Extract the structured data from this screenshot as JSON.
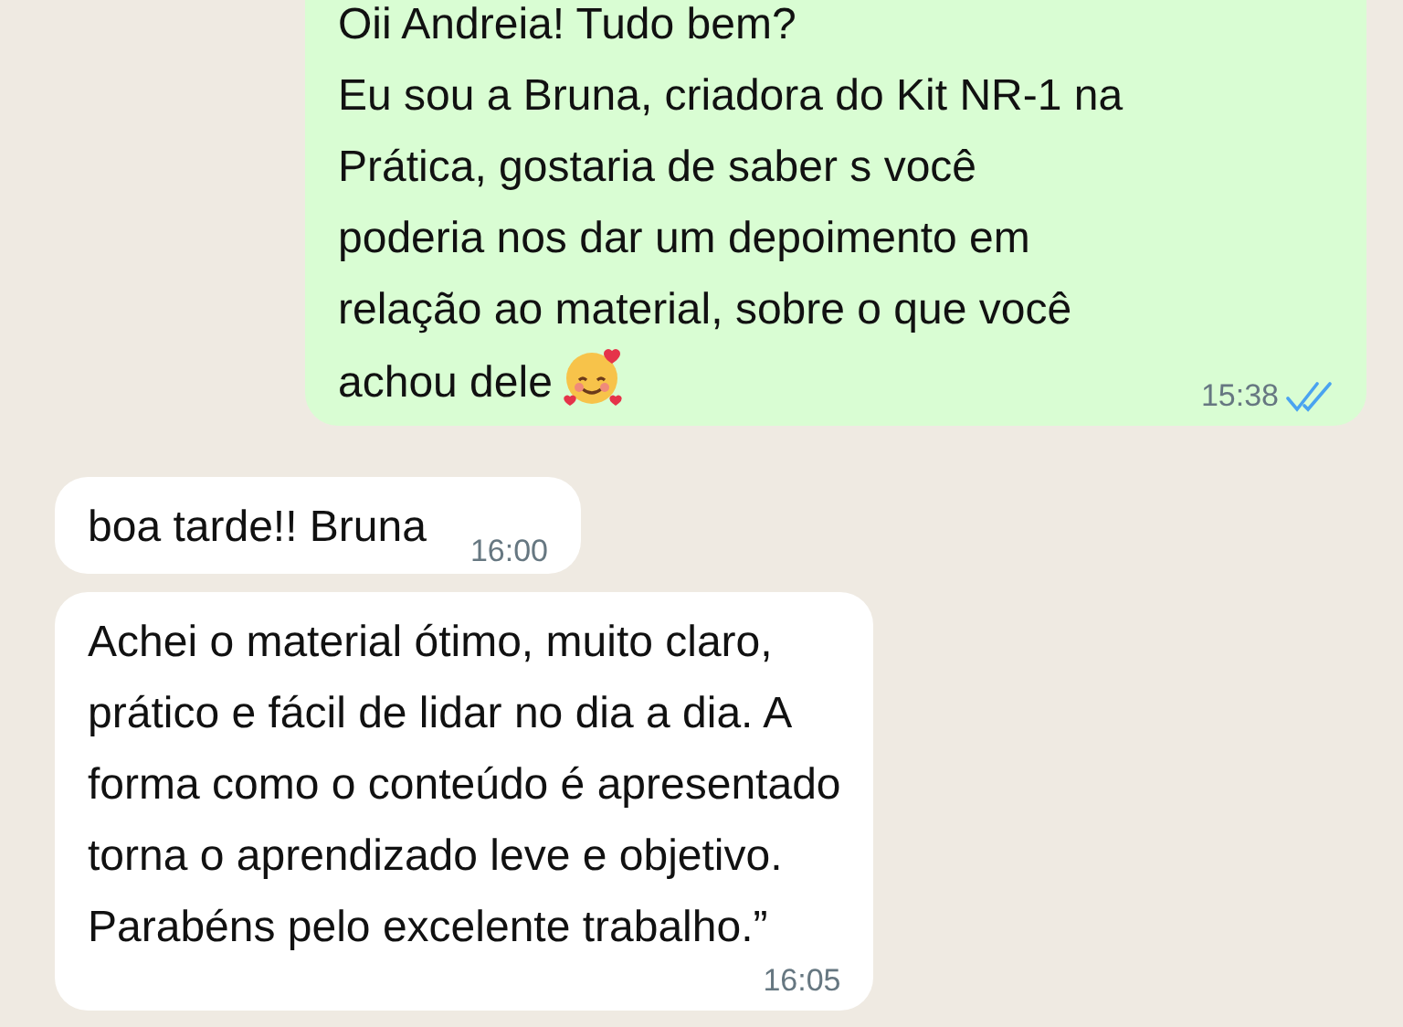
{
  "messages": [
    {
      "kind": "sent",
      "text": "Oii Andreia! Tudo bem?\nEu sou a Bruna, criadora do Kit NR-1 na\nPrática, gostaria de saber s você\npoderia nos dar um depoimento em\nrelação ao material, sobre o que você",
      "last_line": "achou dele",
      "emoji": true,
      "time": "15:38",
      "read": true
    },
    {
      "kind": "received",
      "text": "boa tarde!! Bruna",
      "time": "16:00"
    },
    {
      "kind": "received",
      "text": "Achei o material ótimo, muito claro,\nprático e fácil de lidar no dia a dia. A\nforma como o conteúdo é apresentado\ntorna o aprendizado leve e objetivo.\nParabéns pelo excelente trabalho.”",
      "time": "16:05"
    }
  ]
}
